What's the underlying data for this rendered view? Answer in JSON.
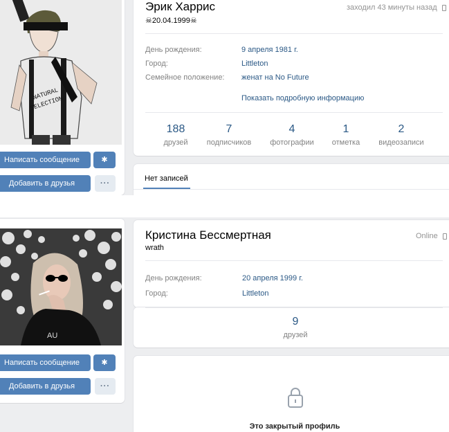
{
  "profile1": {
    "name": "Эрик Харрис",
    "status": "☠20.04.1999☠",
    "last_seen": "заходил 43 минуты назад",
    "info": [
      {
        "label": "День рождения:",
        "value": "9 апреля 1981 г."
      },
      {
        "label": "Город:",
        "value": "Littleton"
      },
      {
        "label": "Семейное положение:",
        "value": "женат на No Future"
      }
    ],
    "more_info": "Показать подробную информацию",
    "counters": [
      {
        "num": "188",
        "label": "друзей"
      },
      {
        "num": "7",
        "label": "подписчиков"
      },
      {
        "num": "4",
        "label": "фотографии"
      },
      {
        "num": "1",
        "label": "отметка"
      },
      {
        "num": "2",
        "label": "видеозаписи"
      }
    ],
    "wall_tab": "Нет записей",
    "message_button": "Написать сообщение",
    "add_friend_button": "Добавить в друзья",
    "more_button": "···",
    "photo_shirt_text": "NATURAL SELECTION"
  },
  "profile2": {
    "name": "Кристина Бессмертная",
    "status": "wrath",
    "online": "Online",
    "info": [
      {
        "label": "День рождения:",
        "value": "20 апреля 1999 г."
      },
      {
        "label": "Город:",
        "value": "Littleton"
      }
    ],
    "counters": [
      {
        "num": "9",
        "label": "друзей"
      }
    ],
    "closed_profile": "Это закрытый профиль",
    "message_button": "Написать сообщение",
    "add_friend_button": "Добавить в друзья",
    "more_button": "···",
    "photo_shirt_text": "AU"
  },
  "colors": {
    "accent": "#5181b8",
    "link": "#2a5885",
    "background": "#edeef0"
  }
}
